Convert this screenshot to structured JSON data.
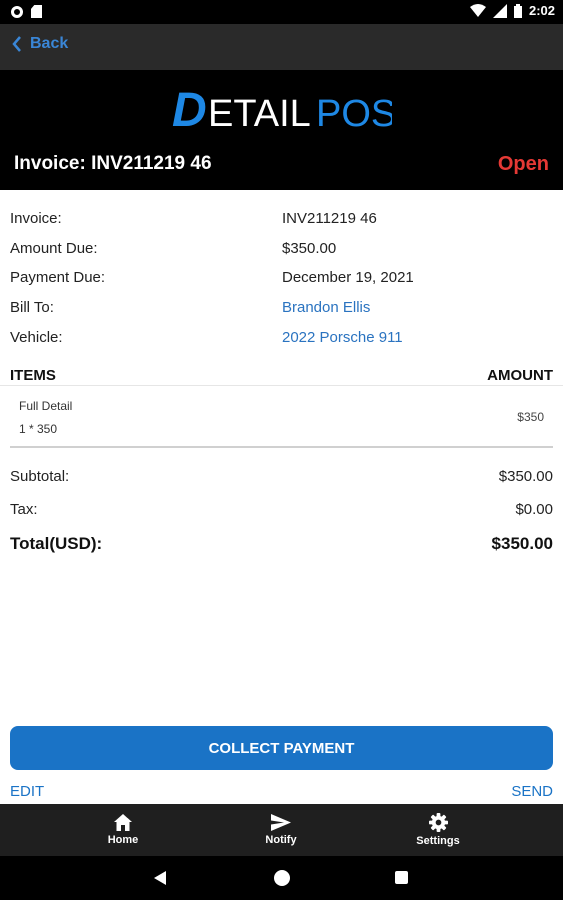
{
  "status_bar": {
    "time": "2:02"
  },
  "nav": {
    "back_label": "Back"
  },
  "brand": {
    "logo_letter": "D",
    "logo_word": "ETAIL",
    "logo_pos": "POS"
  },
  "header": {
    "invoice_title": "Invoice: INV211219 46",
    "status": "Open"
  },
  "details": [
    {
      "label": "Invoice:",
      "value": "INV211219 46"
    },
    {
      "label": "Amount Due:",
      "value": "$350.00"
    },
    {
      "label": "Payment Due:",
      "value": "December 19, 2021"
    },
    {
      "label": "Bill To:",
      "value": "Brandon Ellis"
    },
    {
      "label": "Vehicle:",
      "value": "2022 Porsche 911"
    }
  ],
  "items_table": {
    "col_items": "ITEMS",
    "col_amount": "AMOUNT",
    "rows": [
      {
        "name": "Full Detail",
        "qty": "1 * 350",
        "amount": "$350"
      }
    ]
  },
  "totals": {
    "subtotal_label": "Subtotal:",
    "subtotal": "$350.00",
    "tax_label": "Tax:",
    "tax": "$0.00",
    "total_label": "Total(USD):",
    "total": "$350.00"
  },
  "actions": {
    "collect": "COLLECT PAYMENT",
    "edit": "EDIT",
    "send": "SEND"
  },
  "tabs": [
    {
      "label": "Home",
      "icon": "home-icon"
    },
    {
      "label": "Notify",
      "icon": "send-icon"
    },
    {
      "label": "Settings",
      "icon": "gear-icon"
    }
  ],
  "colors": {
    "accent": "#1a73c6",
    "link": "#2a73c0",
    "open_status": "#e53935",
    "logo_blue": "#1e88e5"
  }
}
